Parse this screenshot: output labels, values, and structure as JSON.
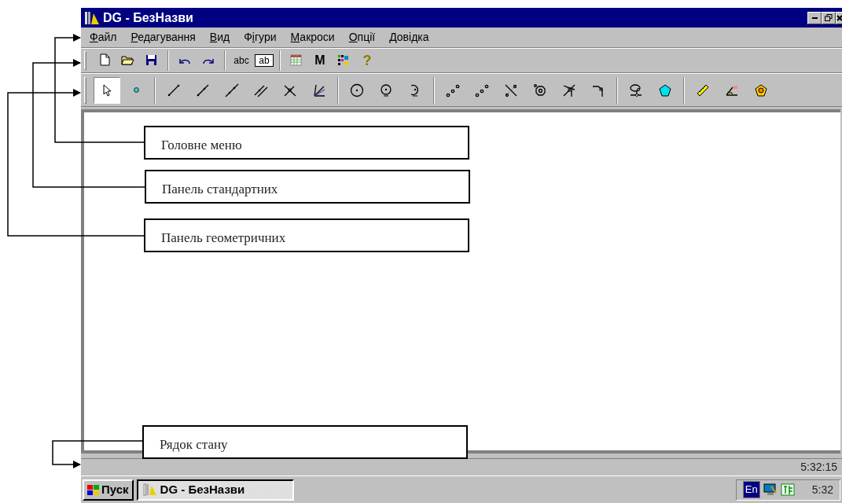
{
  "window": {
    "title": "DG - БезНазви"
  },
  "menu": [
    {
      "accel": "Ф",
      "rest": "айл"
    },
    {
      "accel": "Р",
      "rest": "едагування"
    },
    {
      "accel": "В",
      "rest": "ид"
    },
    {
      "before": "Ф",
      "accel": "і",
      "rest": "гури"
    },
    {
      "accel": "М",
      "rest": "акроси"
    },
    {
      "accel": "О",
      "rest": "пції"
    },
    {
      "accel": "Д",
      "rest": "овідка"
    }
  ],
  "standard_toolbar": [
    {
      "kind": "new"
    },
    {
      "kind": "open"
    },
    {
      "kind": "save"
    },
    {
      "kind": "sep"
    },
    {
      "kind": "undo"
    },
    {
      "kind": "redo"
    },
    {
      "kind": "sep"
    },
    {
      "kind": "glyph",
      "label": "abc"
    },
    {
      "kind": "boxglyph",
      "label": "ab"
    },
    {
      "kind": "sep"
    },
    {
      "kind": "grid"
    },
    {
      "kind": "glyph",
      "label": "M"
    },
    {
      "kind": "palette"
    },
    {
      "kind": "help",
      "label": "?"
    }
  ],
  "geometry_toolbar": [
    {
      "kind": "pointer",
      "selected": true
    },
    {
      "kind": "point",
      "selected": false
    },
    {
      "kind": "sep"
    },
    {
      "kind": "segment",
      "selected": false
    },
    {
      "kind": "ray",
      "selected": false
    },
    {
      "kind": "line",
      "selected": false
    },
    {
      "kind": "parallel",
      "selected": false
    },
    {
      "kind": "perpendicular",
      "selected": false
    },
    {
      "kind": "bisector",
      "selected": false
    },
    {
      "kind": "sep"
    },
    {
      "kind": "circle",
      "selected": false
    },
    {
      "kind": "circle2",
      "selected": false
    },
    {
      "kind": "arc",
      "selected": false
    },
    {
      "kind": "sep"
    },
    {
      "kind": "points",
      "selected": false
    },
    {
      "kind": "points",
      "selected": false
    },
    {
      "kind": "intersect",
      "selected": false
    },
    {
      "kind": "octagon",
      "selected": false
    },
    {
      "kind": "cross",
      "selected": false
    },
    {
      "kind": "corner",
      "selected": false
    },
    {
      "kind": "sep"
    },
    {
      "kind": "locus",
      "selected": false
    },
    {
      "kind": "pentagon",
      "selected": false
    },
    {
      "kind": "sep"
    },
    {
      "kind": "ruler",
      "selected": false
    },
    {
      "kind": "measure",
      "selected": false
    },
    {
      "kind": "shield",
      "selected": false
    }
  ],
  "callouts": [
    {
      "text": "Головне меню"
    },
    {
      "text": "Панель стандартних"
    },
    {
      "text": "Панель геометричних"
    },
    {
      "text": "Рядок стану"
    }
  ],
  "status_bar": {
    "time": "5:32:15"
  },
  "taskbar": {
    "start": "Пуск",
    "tasks": [
      {
        "label": "DG - БезНазви",
        "selected": true
      }
    ],
    "language": "En",
    "clock": "5:32"
  }
}
